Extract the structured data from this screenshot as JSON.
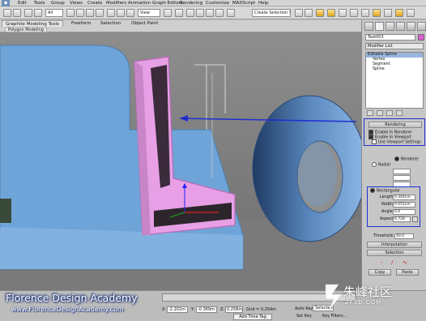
{
  "menubar": {
    "items": [
      "Edit",
      "Tools",
      "Group",
      "Views",
      "Create",
      "Modifiers",
      "Animation",
      "Graph Editors",
      "Rendering",
      "Customize",
      "MAXScript",
      "Help"
    ]
  },
  "toolbar": {
    "view_dropdown": "View",
    "selection_set_placeholder": "Create Selection Se",
    "filter_dropdown": "All"
  },
  "ribbon": {
    "tabs": [
      "Graphite Modeling Tools",
      "Freeform",
      "Selection",
      "Object Paint"
    ],
    "subtab": "Polygon Modeling"
  },
  "command_panel": {
    "object_name": "Text003",
    "modifier_list": "Modifier List",
    "stack": [
      "Editable Spline",
      "Vertex",
      "Segment",
      "Spline"
    ],
    "rendering": {
      "header": "Rendering",
      "enable_in_renderer": "Enable In Renderer",
      "enable_in_viewport": "Enable In Viewport",
      "use_viewport_settings": "Use Viewport Settings",
      "renderer_label": "Renderer",
      "radial_label": "Radial",
      "rectangular_label": "Rectangular",
      "length_label": "Length:",
      "length_value": "0.344cm",
      "width_label": "Width:",
      "width_value": "0.051cm",
      "angle_label": "Angle:",
      "angle_value": "0.0",
      "aspect_label": "Aspect:",
      "aspect_value": "6.728",
      "threshold_label": "Threshold:",
      "threshold_value": "40.0"
    },
    "interpolation_header": "Interpolation",
    "selection_header": "Selection",
    "copy_label": "Copy",
    "paste_label": "Paste"
  },
  "statusbar": {
    "x_label": "X:",
    "x_value": "-2.202m",
    "y_label": "Y:",
    "y_value": "-0.369m",
    "z_label": "Z:",
    "z_value": "0.258m",
    "grid": "Grid = 0.254m",
    "auto_key": "Auto Key",
    "selected": "Selected",
    "set_key": "Set Key",
    "key_filters": "Key Filters...",
    "add_time_tag": "Add Time Tag"
  },
  "watermark": {
    "line1": "Florence Design Academy",
    "line2": "www.FlorenceDesignAcademy.com"
  },
  "site_logo": {
    "text": "朱峰社区",
    "url": "ZF3D.COM"
  },
  "colors": {
    "viewport_bg": "#7f7f7f",
    "blue_object": "#6fa4d8",
    "pink_object": "#e7a0e6",
    "annotation_blue": "#1f2ed0"
  }
}
